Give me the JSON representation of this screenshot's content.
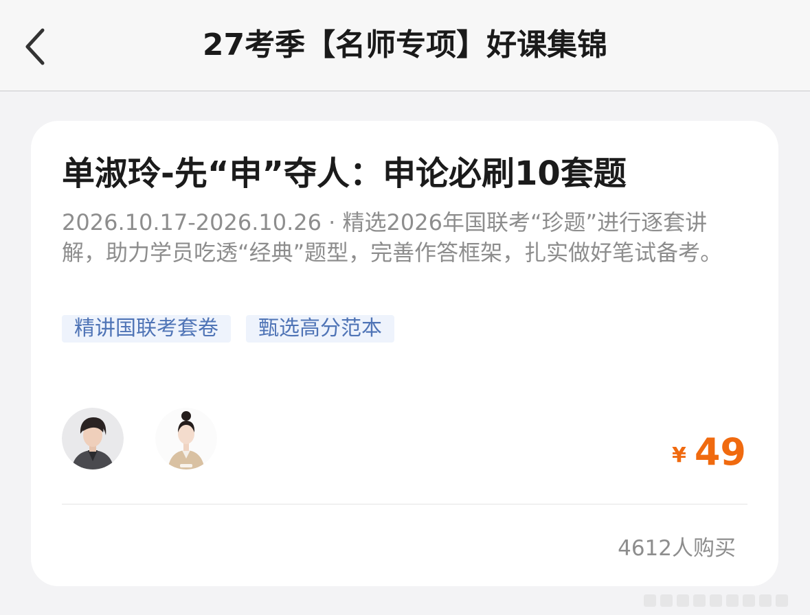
{
  "nav": {
    "back_icon": "chevron-left-icon",
    "title": "27考季【名师专项】好课集锦"
  },
  "course": {
    "title": "单淑玲-先“申”夺人：申论必刷10套题",
    "description": "2026.10.17-2026.10.26 · 精选2026年国联考“珍题”进行逐套讲解，助力学员吃透“经典”题型，完善作答框架，扎实做好笔试备考。",
    "tags": [
      "精讲国联考套卷",
      "甄选高分范本"
    ],
    "teachers": [
      "teacher-avatar-1",
      "teacher-avatar-2"
    ],
    "price_currency": "¥",
    "price_amount": "49",
    "buyers": "4612人购买"
  },
  "colors": {
    "accent_price": "#f06a0f",
    "tag_text": "#4f74b6",
    "tag_bg": "#eef3fc",
    "desc_text": "#8d8d8d"
  }
}
